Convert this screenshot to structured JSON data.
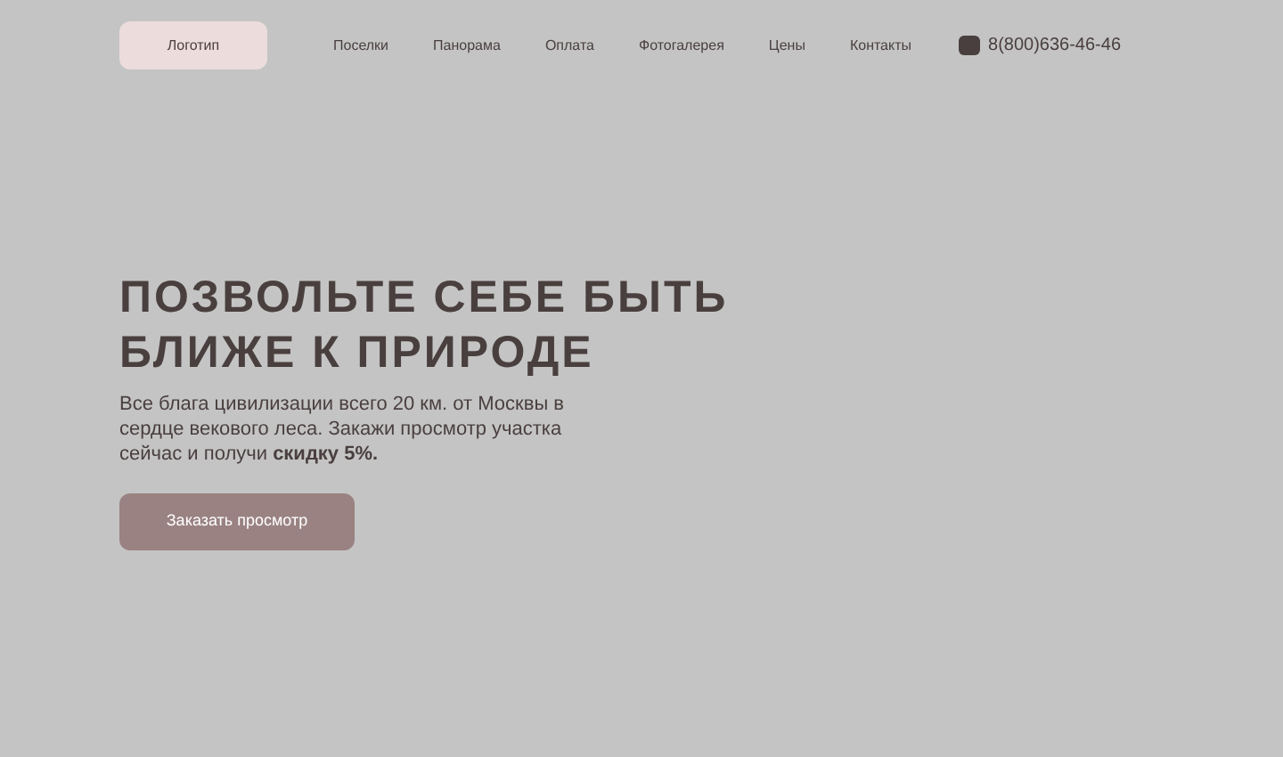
{
  "header": {
    "logo": "Логотип",
    "nav": [
      {
        "label": "Поселки"
      },
      {
        "label": "Панорама"
      },
      {
        "label": "Оплата"
      },
      {
        "label": "Фотогалерея"
      },
      {
        "label": "Цены"
      },
      {
        "label": "Контакты"
      }
    ],
    "phone": "8(800)636-46-46"
  },
  "hero": {
    "title_lines": [
      "ПОЗВОЛЬТЕ СЕБЕ БЫТЬ",
      "БЛИЖЕ К ПРИРОДЕ"
    ],
    "text": "Все блага цивилизации всего 20 км. от Москвы в сердце векового леса. Закажи просмотр участка сейчас и получи **скидку 5%.**",
    "button": "Заказать просмотр"
  }
}
